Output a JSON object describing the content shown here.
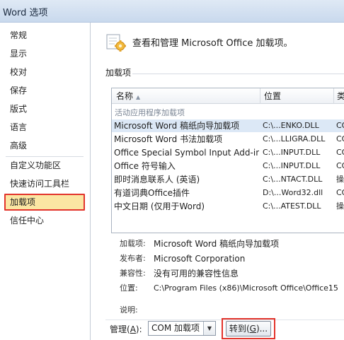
{
  "window": {
    "title": "Word 选项"
  },
  "sidebar": {
    "items": [
      {
        "label": "常规"
      },
      {
        "label": "显示"
      },
      {
        "label": "校对"
      },
      {
        "label": "保存"
      },
      {
        "label": "版式"
      },
      {
        "label": "语言"
      },
      {
        "label": "高级"
      },
      {
        "label": "自定义功能区"
      },
      {
        "label": "快速访问工具栏"
      },
      {
        "label": "加载项",
        "active": true
      },
      {
        "label": "信任中心"
      }
    ]
  },
  "header": {
    "title": "查看和管理 Microsoft Office 加载项。"
  },
  "addins": {
    "section_label": "加载项",
    "columns": [
      "名称",
      "位置",
      "类"
    ],
    "group_label": "活动应用程序加载项",
    "rows": [
      {
        "name": "Microsoft Word 稿纸向导加载项",
        "path": "C:\\...ENKO.DLL",
        "type": "CO"
      },
      {
        "name": "Microsoft Word 书法加载项",
        "path": "C:\\...LLIGRA.DLL",
        "type": "CO"
      },
      {
        "name": "Office Special Symbol Input Add-in",
        "path": "C:\\...INPUT.DLL",
        "type": "CO"
      },
      {
        "name": "Office 符号输入",
        "path": "C:\\...INPUT.DLL",
        "type": "CO"
      },
      {
        "name": "即时消息联系人 (英语)",
        "path": "C:\\...NTACT.DLL",
        "type": "操"
      },
      {
        "name": "有道词典Office插件",
        "path": "D:\\...Word32.dll",
        "type": "CO"
      },
      {
        "name": "中文日期 (仅用于Word)",
        "path": "C:\\...ATEST.DLL",
        "type": "操"
      }
    ]
  },
  "details": {
    "addin_label": "加载项:",
    "addin_value": "Microsoft Word 稿纸向导加载项",
    "publisher_label": "发布者:",
    "publisher_value": "Microsoft Corporation",
    "compat_label": "兼容性:",
    "compat_value": "没有可用的兼容性信息",
    "location_label": "位置:",
    "location_value": "C:\\Program Files (x86)\\Microsoft Office\\Office15",
    "desc_label": "说明:"
  },
  "manage": {
    "label": "管理",
    "label_key": "A",
    "label_close": "):",
    "label_open": "(",
    "selected": "COM 加载项",
    "go_label": "转到",
    "go_key": "G",
    "go_suffix": ")...",
    "go_open": "("
  }
}
